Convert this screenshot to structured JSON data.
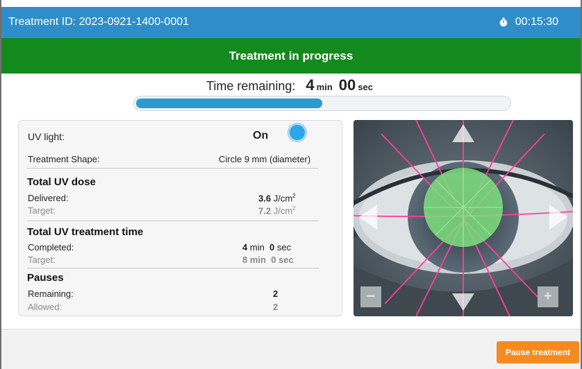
{
  "header": {
    "treatment_id": "Treatment ID: 2023-0921-1400-0001",
    "timer_icon": "stopwatch-icon",
    "elapsed": "00:15:30"
  },
  "status": {
    "text": "Treatment in progress",
    "color": "#138a1d"
  },
  "time_remaining": {
    "label": "Time remaining:",
    "min_value": "4",
    "min_unit": "min",
    "sec_value": "00",
    "sec_unit": "sec",
    "progress_fraction": 0.5
  },
  "panel": {
    "uv_light_label": "UV light:",
    "uv_light_value": "On",
    "shape_label": "Treatment Shape:",
    "shape_value": "Circle 9 mm (diameter)",
    "dose": {
      "title": "Total UV dose",
      "delivered_label": "Delivered:",
      "delivered_value": "3.6",
      "target_label": "Target:",
      "target_value": "7.2",
      "unit_base": "J/cm",
      "unit_exp": "2"
    },
    "time": {
      "title": "Total UV treatment time",
      "completed_label": "Completed:",
      "completed_min": "4",
      "completed_sec": "0",
      "target_label": "Target:",
      "target_min": "8",
      "target_sec": "0",
      "min_unit": "min",
      "sec_unit": "sec"
    },
    "pauses": {
      "title": "Pauses",
      "remaining_label": "Remaining:",
      "remaining_value": "2",
      "allowed_label": "Allowed:",
      "allowed_value": "2"
    }
  },
  "camera": {
    "zoom_out_label": "−",
    "zoom_in_label": "+",
    "icons": [
      "arrow-up-icon",
      "arrow-down-icon",
      "arrow-left-icon",
      "arrow-right-icon"
    ]
  },
  "footer": {
    "pause_label": "Pause treatment",
    "pause_color": "#f58a1f"
  },
  "colors": {
    "header": "#2f8ec9",
    "progress": "#2f9ad2",
    "uv_indicator": "#2aa7e8"
  }
}
